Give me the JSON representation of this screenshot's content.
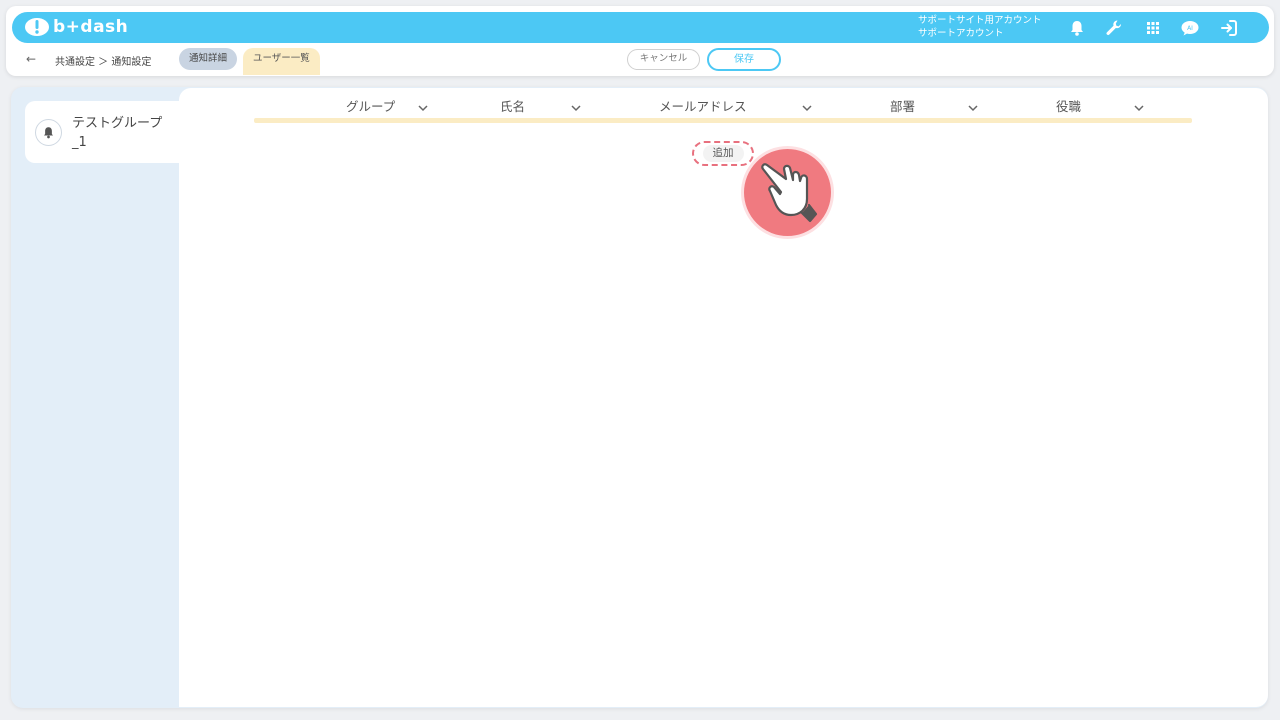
{
  "app": {
    "logo_text": "b+dash"
  },
  "account": {
    "line1": "サポートサイト用アカウント",
    "line2": "サポートアカウント"
  },
  "header_icons": [
    "bell-icon",
    "wrench-icon",
    "grid-icon",
    "chat-icon",
    "logout-icon"
  ],
  "breadcrumb": {
    "back": "←",
    "path": "共通設定 ＞ 通知設定"
  },
  "tabs": [
    {
      "label": "通知詳細"
    },
    {
      "label": "ユーザー一覧"
    }
  ],
  "actions": {
    "cancel": "キャンセル",
    "save": "保存"
  },
  "groups": [
    {
      "name": "テストグループ_1"
    }
  ],
  "table": {
    "columns": [
      "グループ",
      "氏名",
      "メールアドレス",
      "部署",
      "役職"
    ],
    "add_button": "追加"
  },
  "colors": {
    "accent": "#4cc8f4",
    "tab_active": "#fbecc4",
    "highlight": "#e8707e"
  }
}
